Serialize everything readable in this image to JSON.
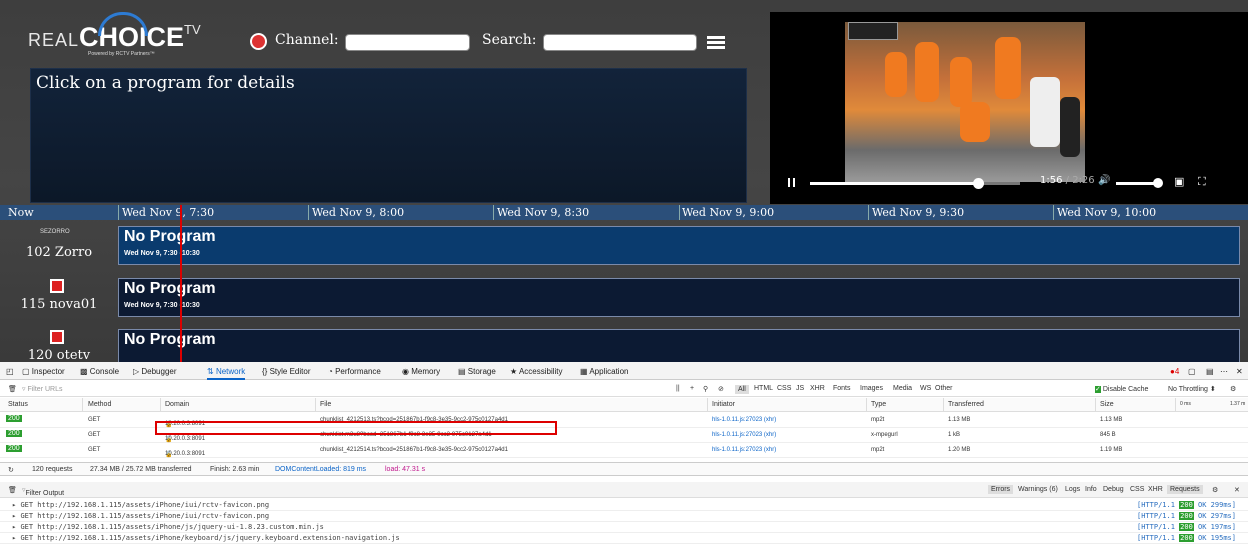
{
  "app": {
    "logo": {
      "word1": "REAL",
      "word2": "CHOICE",
      "word3": "TV",
      "sub": "Powered by RCTV Partners™"
    },
    "channel_label": "Channel:",
    "search_label": "Search:",
    "details_text": "Click on a program for details",
    "video": {
      "time_current": "1:56",
      "time_total": "/ 2:26",
      "progress_fraction": 0.8,
      "volume_fraction": 0.95
    }
  },
  "timeline": {
    "now_label": "Now",
    "slots": [
      "Wed Nov 9, 7:30",
      "Wed Nov 9, 8:00",
      "Wed Nov 9, 8:30",
      "Wed Nov 9, 9:00",
      "Wed Nov 9, 9:30",
      "Wed Nov 9, 10:00"
    ]
  },
  "channels": [
    {
      "name": "102 Zorro",
      "logo_text": "SEZORRO",
      "program": "No Program",
      "time": "Wed Nov 9, 7:30 -10:30"
    },
    {
      "name": "115 nova01",
      "program": "No Program",
      "time": "Wed Nov 9, 7:30 -10:30"
    },
    {
      "name": "120 otetv",
      "program": "No Program",
      "time": ""
    }
  ],
  "devtools": {
    "tabs": [
      "Inspector",
      "Console",
      "Debugger",
      "Network",
      "Style Editor",
      "Performance",
      "Memory",
      "Storage",
      "Accessibility",
      "Application"
    ],
    "filter_placeholder": "Filter URLs",
    "filter_types": [
      "All",
      "HTML",
      "CSS",
      "JS",
      "XHR",
      "Fonts",
      "Images",
      "Media",
      "WS",
      "Other"
    ],
    "disable_cache": "Disable Cache",
    "throttling": "No Throttling ⬍",
    "columns": [
      "Status",
      "Method",
      "Domain",
      "File",
      "Initiator",
      "Type",
      "Transferred",
      "Size",
      "0 ms",
      "1.37 m"
    ],
    "rows": [
      {
        "status": "200",
        "method": "GET",
        "domain": "10.20.0.3:8091",
        "file": "chunklist_4212513.ts?bcod=251867b1-f9c8-3e35-9cc2-975c0127a4d1",
        "initiator": "hls-1.0.11.js:27023 (xhr)",
        "type": "mp2t",
        "transferred": "1.13 MB",
        "size": "1.13 MB"
      },
      {
        "status": "200",
        "method": "GET",
        "domain": "10.20.0.3:8091",
        "file": "chunklist.m3u8?bcod=251867b1-f9c8-3e35-9cc2-975c0127a4d1",
        "initiator": "hls-1.0.11.js:27023 (xhr)",
        "type": "x-mpegurl",
        "transferred": "1 kB",
        "size": "845 B"
      },
      {
        "status": "200",
        "method": "GET",
        "domain": "10.20.0.3:8091",
        "file": "chunklist_4212514.ts?bcod=251867b1-f9c8-3e35-9cc2-975c0127a4d1",
        "initiator": "hls-1.0.11.js:27023 (xhr)",
        "type": "mp2t",
        "transferred": "1.20 MB",
        "size": "1.19 MB"
      }
    ],
    "summary": {
      "requests": "120 requests",
      "transferred": "27.34 MB / 25.72 MB transferred",
      "finish": "Finish: 2.63 min",
      "dcl": "DOMContentLoaded: 819 ms",
      "load": "load: 47.31 s"
    },
    "console": {
      "filter_placeholder": "Filter Output",
      "levels": [
        "Errors",
        "Warnings (6)",
        "Logs",
        "Info",
        "Debug",
        "CSS",
        "XHR",
        "Requests"
      ],
      "logs": [
        {
          "url": "GET http://192.168.1.115/assets/iPhone/iui/rctv-favicon.png",
          "proto": "[HTTP/1.1",
          "code": "200",
          "rest": "OK 299ms]"
        },
        {
          "url": "GET http://192.168.1.115/assets/iPhone/iui/rctv-favicon.png",
          "proto": "[HTTP/1.1",
          "code": "200",
          "rest": "OK 297ms]"
        },
        {
          "url": "GET http://192.168.1.115/assets/iPhone/js/jquery-ui-1.8.23.custom.min.js",
          "proto": "[HTTP/1.1",
          "code": "200",
          "rest": "OK 197ms]"
        },
        {
          "url": "GET http://192.168.1.115/assets/iPhone/keyboard/js/jquery.keyboard.extension-navigation.js",
          "proto": "[HTTP/1.1",
          "code": "200",
          "rest": "OK 195ms]"
        }
      ]
    },
    "errors_badge": "4"
  }
}
